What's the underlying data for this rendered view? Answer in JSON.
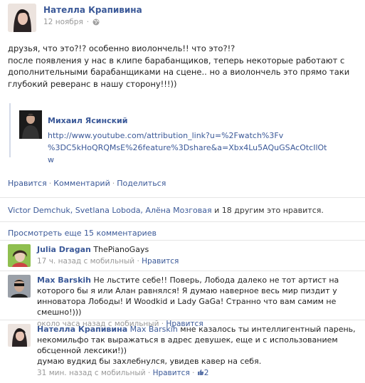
{
  "post": {
    "author": "Нателла Крапивина",
    "date": "12 ноября",
    "text_lines": [
      "друзья, что это?!? особенно виолончель!! что это?!?",
      "после появления у нас в клипе барабанщиков, теперь некоторые работают с",
      "дополнительными барабанщиками на сцене.. но а виолончель это прямо таки",
      "глубокий реверанс в нашу сторону!!!))"
    ]
  },
  "share": {
    "author": "Михаил Ясинский",
    "link_line1": "http://www.youtube.com/attribution_link?u=%2Fwatch%3Fv",
    "link_line2": "%3DC5kHoQRQMsE%26feature%3Dshare&a=Xbx4Lu5AQuGSAcOtcIlOtw"
  },
  "actions": {
    "like": "Нравится",
    "comment": "Комментарий",
    "share": "Поделиться"
  },
  "likes": {
    "names": "Victor Demchuk, Svetlana Loboda, Алёна Мозговая",
    "rest": " и 18 другим это нравится."
  },
  "more_comments": "Просмотреть еще 15 комментариев",
  "comments": [
    {
      "author": "Julia Dragan",
      "text": "ThePianoGays",
      "time": "17 ч. назад с мобильный",
      "like": "Нравится"
    },
    {
      "author": "Max Barskih",
      "text": "Не льстите себе!! Поверь, Лобода далеко не тот артист на которого бы я или Алан равнялся! Я думаю наверное весь мир пиздит у инноватора Лободы! И Woodkid и Lady GaGa! Странно что вам самим не смешно!)))",
      "time": "около часа назад с мобильный",
      "like": "Нравится"
    },
    {
      "author": "Нателла Крапивина",
      "mention": "Max Barskih",
      "text": " мне казалось ты интеллигентный парень, некомильфо так выражаться в адрес девушек, еще и с использованием обсценной лексики!))",
      "text2": "думаю вудкид бы захлебнулся, увидев кавер на себя.",
      "time": "31 мин. назад с мобильный",
      "like": "Нравится",
      "like_count": "2"
    }
  ]
}
